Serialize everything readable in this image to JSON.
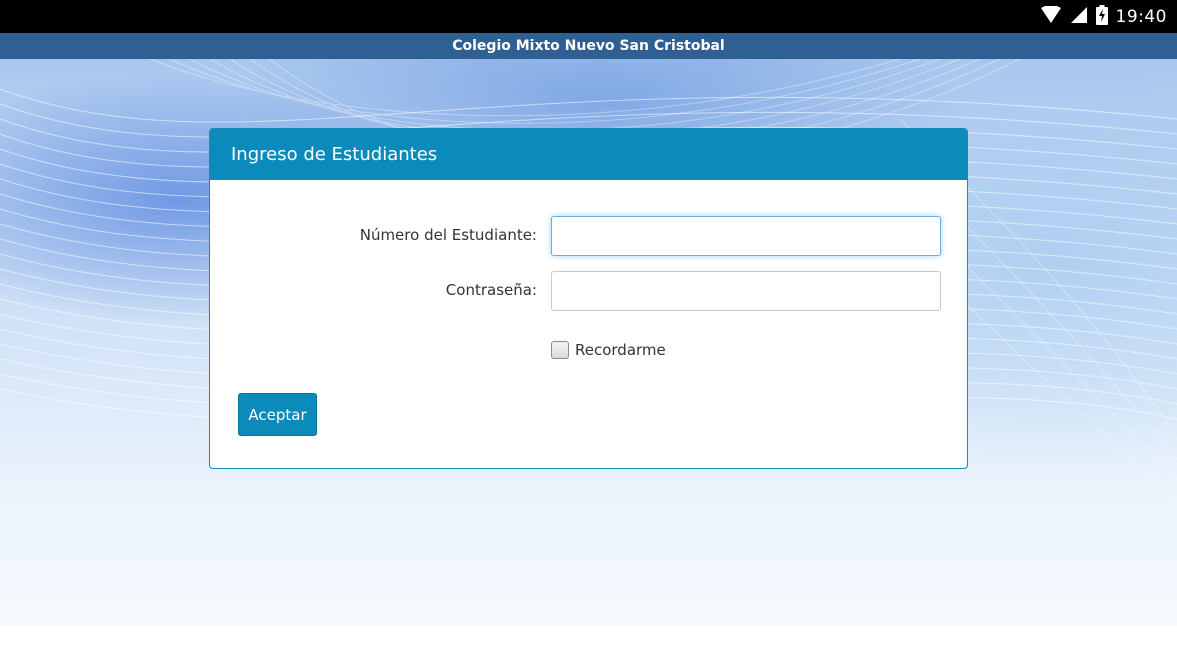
{
  "status_bar": {
    "time": "19:40",
    "icons": [
      "wifi-icon",
      "cell-signal-icon",
      "battery-charging-icon"
    ]
  },
  "app_bar": {
    "title": "Colegio Mixto Nuevo San Cristobal"
  },
  "login_panel": {
    "title": "Ingreso de Estudiantes",
    "student_number_label": "Número del Estudiante:",
    "student_number_value": "",
    "password_label": "Contraseña:",
    "password_value": "",
    "remember_label": "Recordarme",
    "remember_checked": false,
    "accept_label": "Aceptar"
  },
  "colors": {
    "status_bar": "#000000",
    "app_bar": "#2f5f93",
    "panel_header": "#0b8bbb",
    "button": "#0b8bbb",
    "focus_ring": "#66afe9"
  }
}
